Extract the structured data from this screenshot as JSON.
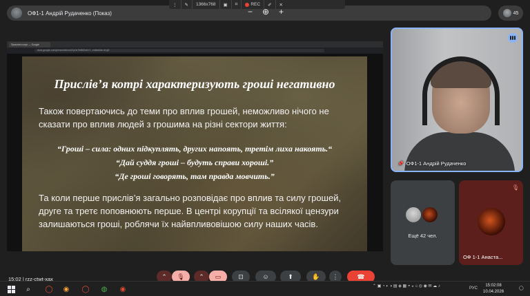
{
  "meeting": {
    "title": "ОФ1-1 Андрій Рудаченко (Показ)",
    "participants_count": "45",
    "code": "15:02 | rzz-ctwt-xax"
  },
  "capture_bar": {
    "resolution": "1366x768",
    "rec_label": "REC"
  },
  "zoom": {
    "minus": "−",
    "plus": "+"
  },
  "browser": {
    "tab_title": "Прислів'я котрі — Google",
    "url": "docs.google.com/presentation/d/1p0s7lbB8ZsKcY...edit#slide=id.g5"
  },
  "slide": {
    "title": "Прислів’я котрі характеризують гроші негативно",
    "paragraph1": "Також повертаючись до теми про вплив грошей, неможливо нічого не сказати про вплив людей з грошима на різні сектори життя:",
    "quote1": "“Гроші – сила: одних підкуплять, других напоять, третім лиха накоять.“",
    "quote2": "“Дай суддя гроші – будуть справи хороші.”",
    "quote3": "“Де гроші говорять, там правда мовчить.”",
    "paragraph2": "Та коли перше прислів’я загально розповідає про вплив та силу грошей, друге та третє поповнюють перше. В центрі корупції та всілякої цензури залишаються гроші, роблячи їх найвпливовішою силу наших часів."
  },
  "tiles": {
    "main_name": "ОФ1-1 Андрій Рудаченко",
    "others_label": "Ещё 42 чел.",
    "anast_name": "ОФ 1-1 Анаста..."
  },
  "taskbar": {
    "lang": "РУС",
    "time": "15:02:08",
    "date": "10.04.2026"
  },
  "colors": {
    "accent": "#8ab4f8",
    "end_call": "#ea4335",
    "mic_off": "#f6aea9"
  }
}
